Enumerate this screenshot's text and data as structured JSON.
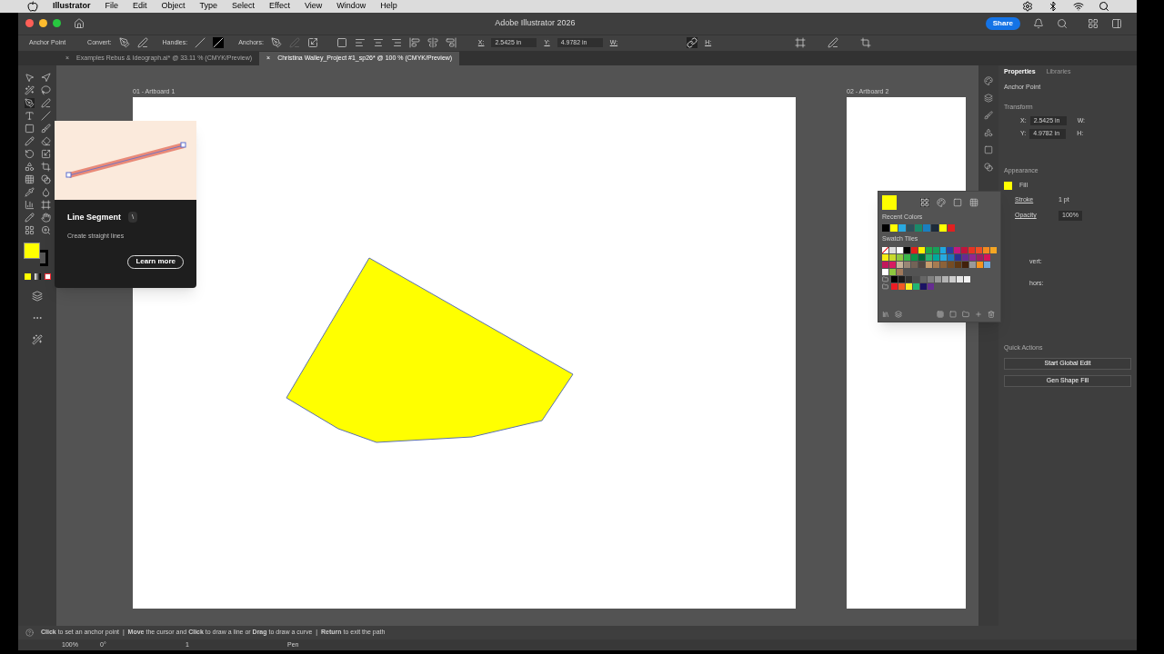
{
  "menu_bar": {
    "app": "Illustrator",
    "items": [
      "File",
      "Edit",
      "Object",
      "Type",
      "Select",
      "Effect",
      "View",
      "Window",
      "Help"
    ]
  },
  "window": {
    "title": "Adobe Illustrator 2026",
    "share": "Share"
  },
  "control_bar": {
    "selection": "Anchor Point",
    "convert": "Convert:",
    "handles": "Handles:",
    "anchors": "Anchors:",
    "x_label": "X:",
    "x_value": "2.5425 in",
    "y_label": "Y:",
    "y_value": "4.9782 in",
    "w_label": "W:",
    "h_label": "H:"
  },
  "tabs": [
    {
      "close": "×",
      "label": "Examples Rebus & Ideograph.ai* @ 33.11 % (CMYK/Preview)",
      "selected": false
    },
    {
      "close": "×",
      "label": "Christina Walley_Project #1_sp26* @ 100 % (CMYK/Preview)",
      "selected": true
    }
  ],
  "artboards": [
    {
      "name": "01 - Artboard 1"
    },
    {
      "name": "02 - Artboard 2"
    }
  ],
  "fill": {
    "color": "#ffff00"
  },
  "tooltip": {
    "title": "Line Segment",
    "shortcut": "\\",
    "description": "Create straight lines",
    "button": "Learn more"
  },
  "swatch_popup": {
    "current": {
      "color": "#ffff00"
    },
    "recent_label": "Recent Colors",
    "recent": [
      {
        "color": "#000000"
      },
      {
        "color": "#ffff00"
      },
      {
        "color": "#29a9e0"
      },
      {
        "color": "#2f4f5a"
      },
      {
        "color": "#1a8a6a"
      },
      {
        "color": "#1a7fc0"
      },
      {
        "color": "#1d2b3a"
      },
      {
        "color": "#ffff00"
      },
      {
        "color": "#e02020"
      }
    ],
    "tiles_label": "Swatch Tiles",
    "rows": [
      {
        "kind": "tiles",
        "tiles": [
          {
            "kind": "none",
            "color": "#ffffff"
          },
          {
            "kind": "color",
            "color": "#dddddd"
          },
          {
            "kind": "color",
            "color": "#ffffff"
          },
          {
            "kind": "color",
            "color": "#000000"
          },
          {
            "kind": "color",
            "color": "#e0201b"
          },
          {
            "kind": "color",
            "color": "#fff200"
          },
          {
            "kind": "color",
            "color": "#1fa84a"
          },
          {
            "kind": "color",
            "color": "#16a05a"
          },
          {
            "kind": "color",
            "color": "#1ea9e1"
          },
          {
            "kind": "color",
            "color": "#2c3e9f"
          },
          {
            "kind": "color",
            "color": "#c2197d"
          },
          {
            "kind": "color",
            "color": "#c0143c"
          },
          {
            "kind": "color",
            "color": "#e63323"
          },
          {
            "kind": "color",
            "color": "#ed4e25"
          },
          {
            "kind": "color",
            "color": "#f38a1f"
          },
          {
            "kind": "color",
            "color": "#f5a623"
          }
        ]
      },
      {
        "kind": "tiles",
        "tiles": [
          {
            "kind": "color",
            "color": "#f7ec13"
          },
          {
            "kind": "color",
            "color": "#c8d92b"
          },
          {
            "kind": "color",
            "color": "#8cc63f"
          },
          {
            "kind": "color",
            "color": "#39b54a"
          },
          {
            "kind": "color",
            "color": "#0a9447"
          },
          {
            "kind": "color",
            "color": "#006837"
          },
          {
            "kind": "color",
            "color": "#29b473"
          },
          {
            "kind": "color",
            "color": "#00a99d"
          },
          {
            "kind": "color",
            "color": "#27aae1"
          },
          {
            "kind": "color",
            "color": "#1c75bc"
          },
          {
            "kind": "color",
            "color": "#2e3192"
          },
          {
            "kind": "color",
            "color": "#662d91"
          },
          {
            "kind": "color",
            "color": "#92278f"
          },
          {
            "kind": "color",
            "color": "#9e1f63"
          },
          {
            "kind": "color",
            "color": "#d4145a"
          }
        ]
      },
      {
        "kind": "tiles",
        "tiles": [
          {
            "kind": "color",
            "color": "#c2185b"
          },
          {
            "kind": "color",
            "color": "#d81b60"
          },
          {
            "kind": "color",
            "color": "#c7b299"
          },
          {
            "kind": "color",
            "color": "#998675"
          },
          {
            "kind": "color",
            "color": "#736357"
          },
          {
            "kind": "color",
            "color": "#534741"
          },
          {
            "kind": "color",
            "color": "#c69c6d"
          },
          {
            "kind": "color",
            "color": "#a67c52"
          },
          {
            "kind": "color",
            "color": "#8c6239"
          },
          {
            "kind": "color",
            "color": "#754c24"
          },
          {
            "kind": "color",
            "color": "#603813"
          },
          {
            "kind": "color",
            "color": "#42210b"
          },
          {
            "kind": "color",
            "color": "#999999"
          },
          {
            "kind": "color",
            "color": "#f7931e"
          },
          {
            "kind": "color",
            "color": "#6fa8dc"
          }
        ]
      },
      {
        "kind": "tiles",
        "tiles": [
          {
            "kind": "color",
            "color": "#ffffff"
          },
          {
            "kind": "color",
            "color": "#8cc63f"
          },
          {
            "kind": "color",
            "color": "#a0785a"
          }
        ]
      },
      {
        "kind": "group",
        "tiles": [
          {
            "kind": "color",
            "color": "#000000"
          },
          {
            "kind": "color",
            "color": "#1a1a1a"
          },
          {
            "kind": "color",
            "color": "#333333"
          },
          {
            "kind": "color",
            "color": "#4d4d4d"
          },
          {
            "kind": "color",
            "color": "#666666"
          },
          {
            "kind": "color",
            "color": "#808080"
          },
          {
            "kind": "color",
            "color": "#999999"
          },
          {
            "kind": "color",
            "color": "#b3b3b3"
          },
          {
            "kind": "color",
            "color": "#cccccc"
          },
          {
            "kind": "color",
            "color": "#e6e6e6"
          },
          {
            "kind": "color",
            "color": "#f2f2f2"
          }
        ]
      },
      {
        "kind": "group",
        "tiles": [
          {
            "kind": "color",
            "color": "#ed1c24"
          },
          {
            "kind": "color",
            "color": "#f15a24"
          },
          {
            "kind": "color",
            "color": "#fcee21"
          },
          {
            "kind": "color",
            "color": "#22b573"
          },
          {
            "kind": "color",
            "color": "#1b1464"
          },
          {
            "kind": "color",
            "color": "#662d91"
          }
        ]
      }
    ]
  },
  "properties": {
    "tabs": [
      {
        "label": "Properties",
        "selected": true
      },
      {
        "label": "Libraries",
        "selected": false
      }
    ],
    "selection": "Anchor Point",
    "transform": "Transform",
    "x_label": "X:",
    "x_value": "2.5425 in",
    "y_label": "Y:",
    "y_value": "4.9782 in",
    "w_label": "W:",
    "h_label": "H:",
    "appearance": "Appearance",
    "fill": "Fill",
    "stroke": "Stroke",
    "stroke_value": "1 pt",
    "opacity": "Opacity",
    "opacity_value": "100%",
    "convert_partial": "vert:",
    "anchors_partial": "hors:",
    "quick_actions": "Quick Actions",
    "buttons": [
      "Start Global Edit",
      "Gen Shape Fill"
    ]
  },
  "hint": "**Click** to set an anchor point  |  **Move** the cursor and **Click** to draw a line or **Drag** to draw a curve  |  **Return** to exit the path",
  "status_bar": {
    "zoom": "100%",
    "rotation": "0°",
    "artboard": "1",
    "tool": "Pen"
  }
}
